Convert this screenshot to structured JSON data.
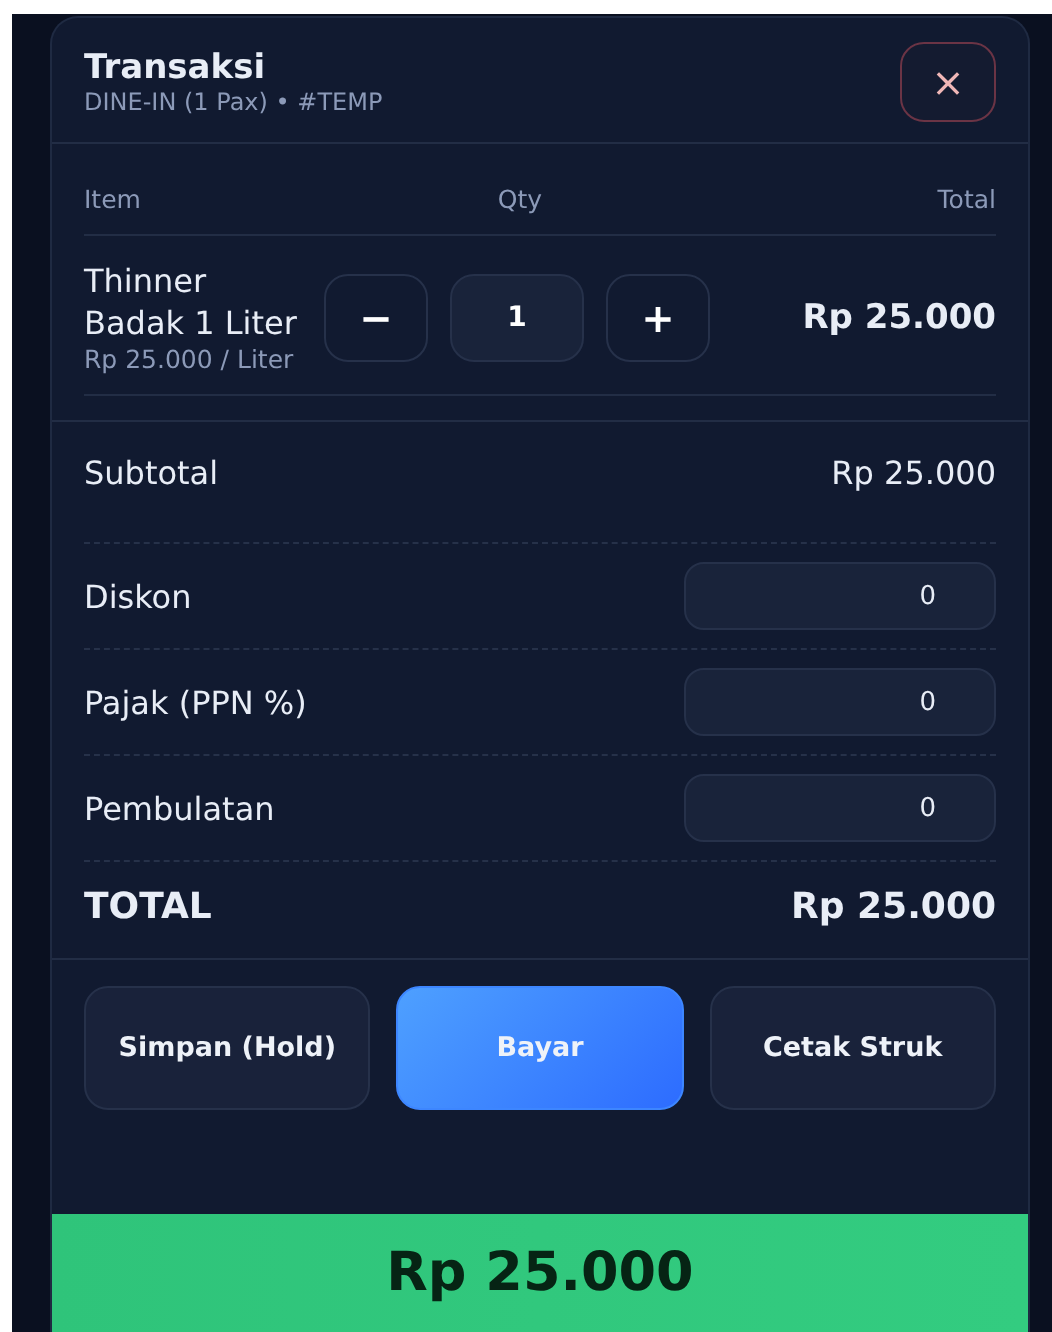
{
  "header": {
    "title": "Transaksi",
    "subtitle": "DINE-IN (1 Pax) • #TEMP",
    "close": "×"
  },
  "table": {
    "columns": [
      "Item",
      "Qty",
      "Total"
    ],
    "rows": [
      {
        "name": "Thinner Badak 1 Liter",
        "unit_price": "Rp 25.000 / Liter",
        "minus": "−",
        "qty": "1",
        "plus": "+",
        "total": "Rp 25.000"
      }
    ]
  },
  "summary": [
    {
      "kind": "text",
      "label": "Subtotal",
      "value": "Rp 25.000"
    },
    {
      "kind": "input",
      "label": "Diskon",
      "value": "0"
    },
    {
      "kind": "input",
      "label": "Pajak (PPN %)",
      "value": "0"
    },
    {
      "kind": "input",
      "label": "Pembulatan",
      "value": "0"
    },
    {
      "kind": "total",
      "label": "TOTAL",
      "value": "Rp 25.000"
    }
  ],
  "actions": [
    {
      "label": "Simpan (Hold)",
      "kind": "secondary"
    },
    {
      "label": "Bayar",
      "kind": "primary"
    },
    {
      "label": "Cetak Struk",
      "kind": "secondary"
    }
  ],
  "pay_bar": {
    "amount": "Rp 25.000"
  }
}
